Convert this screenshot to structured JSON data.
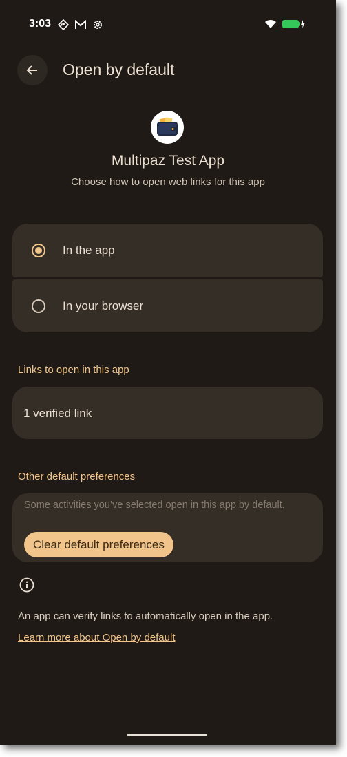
{
  "status_bar": {
    "time": "3:03",
    "icons": [
      "maps-icon",
      "gmail-icon",
      "settings-icon"
    ],
    "right_icons": [
      "wifi-icon",
      "battery-charging-icon"
    ],
    "battery_color": "#34c759"
  },
  "header": {
    "title": "Open by default",
    "back_icon": "arrow-back-icon"
  },
  "app": {
    "icon": "wallet-icon",
    "name": "Multipaz Test App",
    "subtitle": "Choose how to open web links for this app"
  },
  "options": [
    {
      "label": "In the app",
      "selected": true
    },
    {
      "label": "In your browser",
      "selected": false
    }
  ],
  "links_section": {
    "title": "Links to open in this app",
    "verified": "1 verified link"
  },
  "preferences_section": {
    "title": "Other default preferences",
    "description": "Some activities you’ve selected open in this app by default.",
    "clear_label": "Clear default preferences"
  },
  "footer": {
    "info_icon": "info-icon",
    "text": "An app can verify links to automatically open in the app.",
    "learn_more": "Learn more about Open by default"
  },
  "colors": {
    "accent": "#f0c48a",
    "background": "#1f1a15",
    "surface": "#352e27"
  }
}
